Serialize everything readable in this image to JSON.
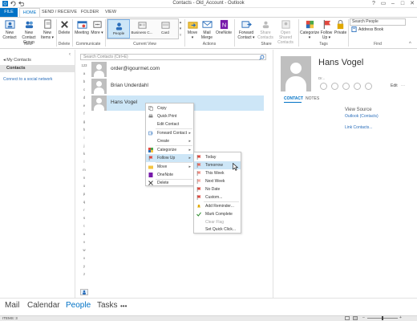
{
  "window": {
    "title": "Contacts - Old_Account - Outlook",
    "controls": [
      "?",
      "▭",
      "–",
      "□",
      "✕"
    ]
  },
  "ribbon_tabs": [
    "FILE",
    "HOME",
    "SEND / RECEIVE",
    "FOLDER",
    "VIEW"
  ],
  "ribbon": {
    "new": {
      "new_contact": "New Contact",
      "new_contact_group": "New Contact Group",
      "new_items": "New Items ▾",
      "group": "New"
    },
    "delete": {
      "label": "Delete",
      "group": "Delete"
    },
    "communicate": {
      "meeting": "Meeting",
      "more": "More ▾",
      "group": "Communicate"
    },
    "current_view": {
      "people": "People",
      "business_card": "Business C...",
      "card": "Card",
      "group": "Current View"
    },
    "actions": {
      "move": "Move ▾",
      "mail_merge": "Mail Merge",
      "onenote": "OneNote",
      "group": "Actions"
    },
    "share": {
      "forward_contact": "Forward Contact ▾",
      "share_contacts": "Share Contacts",
      "open_shared": "Open Shared Contacts",
      "group": "Share"
    },
    "tags": {
      "categorize": "Categorize ▾",
      "follow_up": "Follow Up ▾",
      "private": "Private",
      "group": "Tags"
    },
    "find": {
      "search_placeholder": "Search People",
      "address_book": "Address Book",
      "group": "Find"
    }
  },
  "leftnav": {
    "my_contacts": "◂ My Contacts",
    "contacts": "Contacts",
    "social_link": "Connect to a social network"
  },
  "list": {
    "search_placeholder": "Search Contacts (Ctrl+E)",
    "index": [
      "123",
      "a",
      "b",
      "c",
      "d",
      "e",
      "f",
      "g",
      "h",
      "i",
      "j",
      "k",
      "l",
      "m",
      "n",
      "o",
      "p",
      "q",
      "r",
      "s",
      "t",
      "u",
      "v",
      "w",
      "x",
      "y",
      "z"
    ],
    "contacts": [
      "order@igourmet.com",
      "Brian Underdahl",
      "Hans Vogel"
    ]
  },
  "context_menu": {
    "items": [
      "Copy",
      "Quick Print",
      "Edit Contact",
      "Forward Contact",
      "Create",
      "Categorize",
      "Follow Up",
      "Move",
      "OneNote",
      "Delete"
    ]
  },
  "followup_menu": {
    "items": [
      "Today",
      "Tomorrow",
      "This Week",
      "Next Week",
      "No Date",
      "Custom...",
      "Add Reminder...",
      "Mark Complete",
      "Clear Flag",
      "Set Quick Click..."
    ]
  },
  "reading_pane": {
    "name": "Hans Vogel",
    "dr_label": "Dr...",
    "edit": "Edit",
    "tab_contact": "CONTACT",
    "tab_notes": "NOTES",
    "view_source": "View Source",
    "source_link": "Outlook (Contacts)",
    "link_contacts": "Link Contacts..."
  },
  "bottom_nav": [
    "Mail",
    "Calendar",
    "People",
    "Tasks",
    "•••"
  ],
  "status": {
    "items": "ITEMS: 3"
  },
  "colors": {
    "accent": "#0072c6",
    "selection": "#cde6f7",
    "flag": "#e0483e"
  }
}
